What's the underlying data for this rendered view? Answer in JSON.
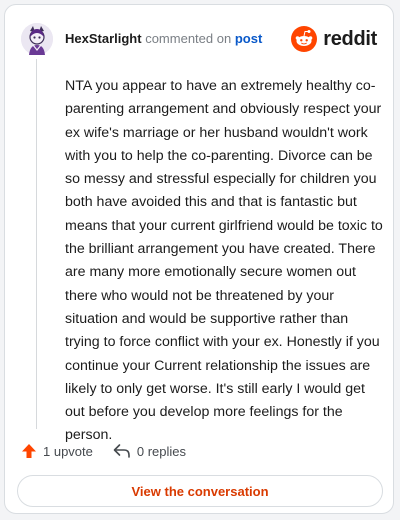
{
  "comment": {
    "username": "HexStarlight",
    "action_text": "commented on",
    "post_link": "post",
    "body": "NTA you appear to have an extremely healthy co-parenting arrangement and obviously respect your ex wife's marriage or her husband wouldn't work with you to help the co-parenting. Divorce can be so messy and stressful especially for children you both have avoided this and that is fantastic but means that your current girlfriend would be toxic to the brilliant arrangement you have created. There are many more emotionally secure women out there who would not be threatened by your situation and would be supportive rather than trying to force conflict with your ex. Honestly if you continue your Current relationship the issues are likely to only get worse. It's still early I would get out before you develop more feelings for the person."
  },
  "brand": {
    "wordmark": "reddit",
    "icon": "reddit-snoo-icon",
    "color": "#ff4500"
  },
  "actions": {
    "upvote_label": "1 upvote",
    "replies_label": "0 replies",
    "upvote_icon": "upvote-arrow-icon",
    "reply_icon": "reply-arrow-icon",
    "upvote_color": "#ff4500"
  },
  "cta": {
    "label": "View the conversation",
    "color": "#d93a00"
  },
  "colors": {
    "link": "#0a59c9",
    "meta": "#7a7f85"
  }
}
